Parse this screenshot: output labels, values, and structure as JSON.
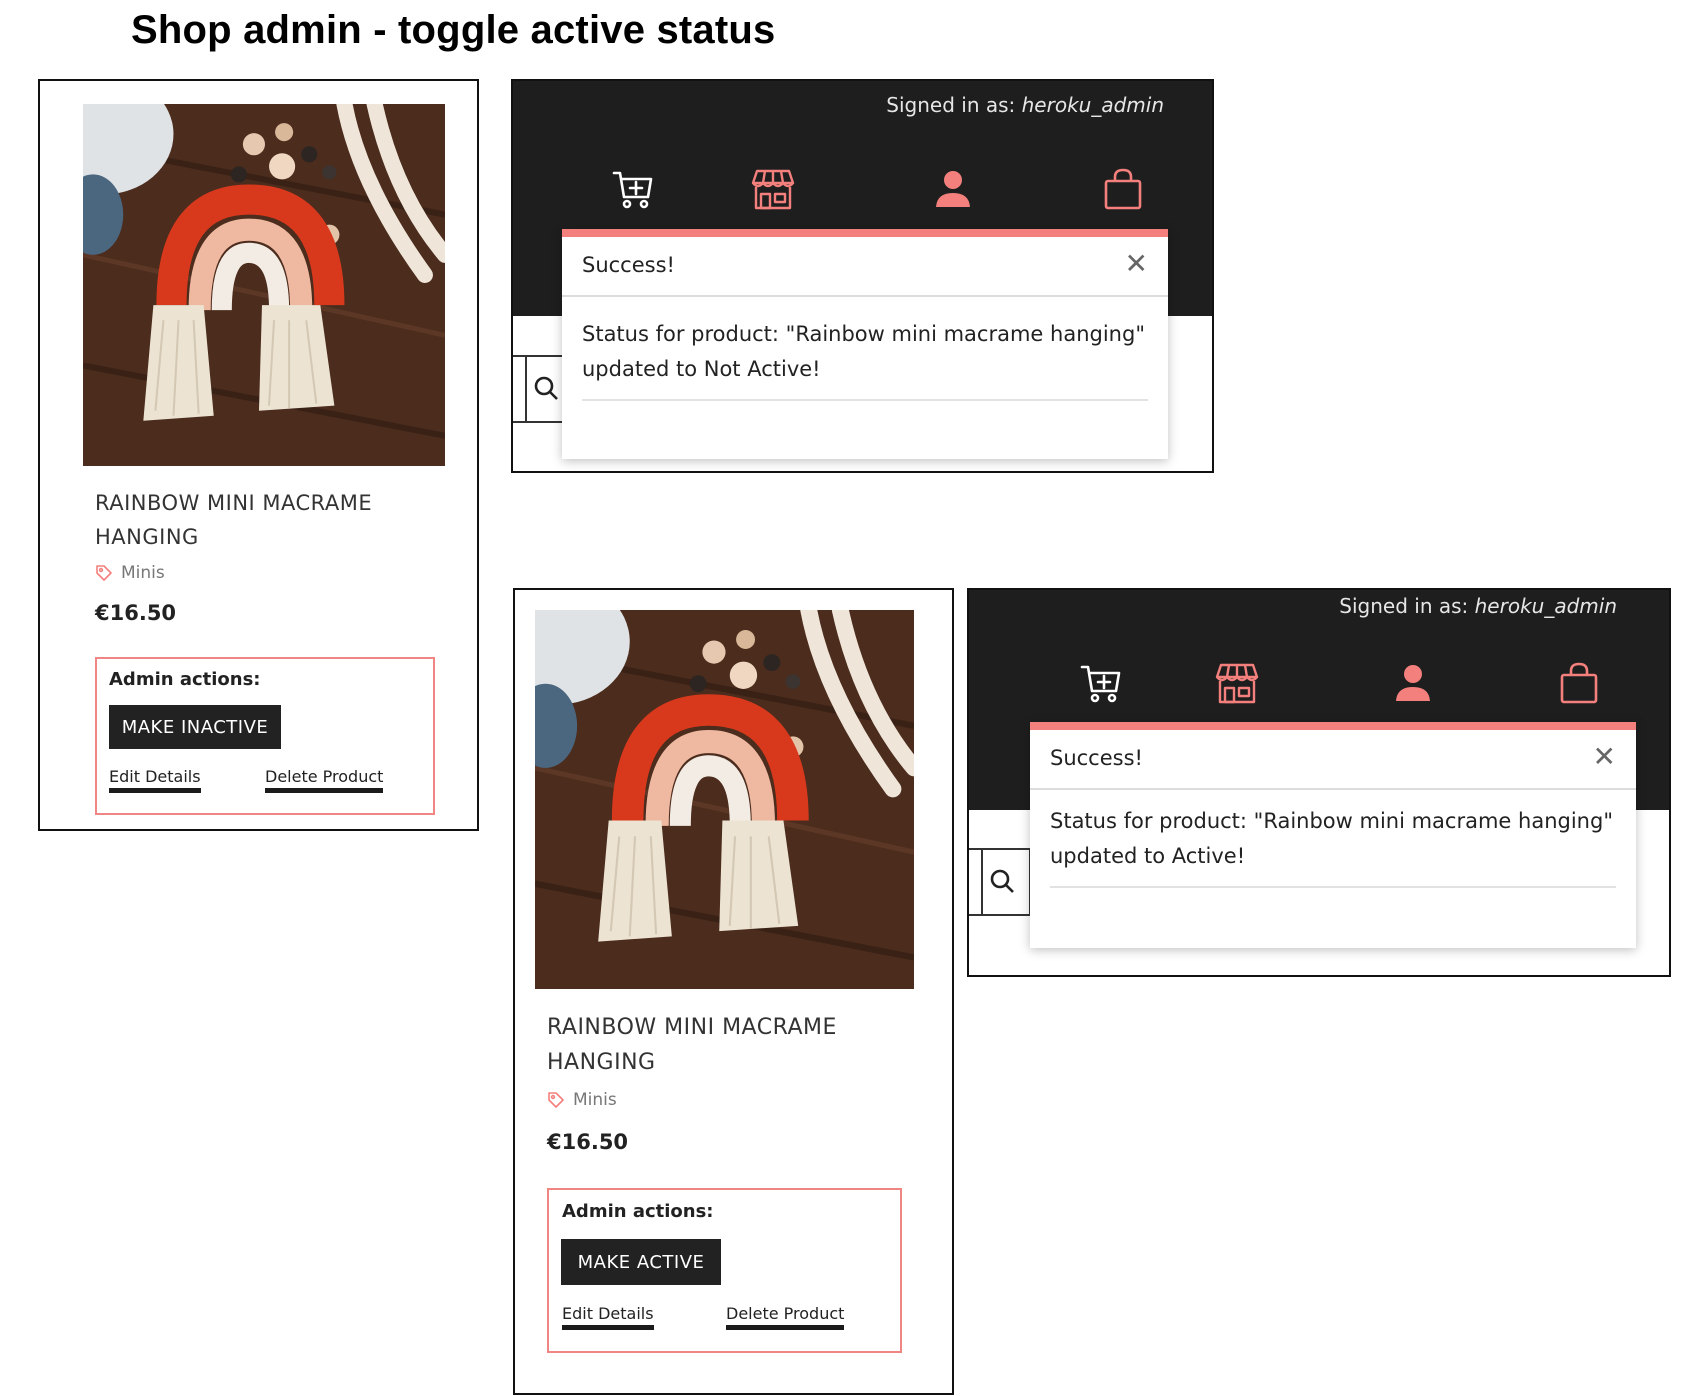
{
  "page": {
    "title": "Shop admin - toggle active status"
  },
  "colors": {
    "accent": "#f4807d",
    "header_bg": "#1e1e1e",
    "button_bg": "#222222"
  },
  "scenario_inactive": {
    "card": {
      "name": "RAINBOW MINI MACRAME HANGING",
      "category": "Minis",
      "price": "€16.50",
      "admin_label": "Admin actions:",
      "toggle_label": "MAKE INACTIVE",
      "edit_label": "Edit Details",
      "delete_label": "Delete Product"
    },
    "header": {
      "signed_in_prefix": "Signed in as:",
      "username": "heroku_admin",
      "icons": [
        "cart-plus-icon",
        "store-icon",
        "user-icon",
        "shopping-bag-icon"
      ]
    },
    "toast": {
      "title": "Success!",
      "close": "✕",
      "message": "Status for product: \"Rainbow mini macrame hanging\" updated to Not Active!"
    }
  },
  "scenario_active": {
    "card": {
      "name": "RAINBOW MINI MACRAME HANGING",
      "category": "Minis",
      "price": "€16.50",
      "admin_label": "Admin actions:",
      "toggle_label": "MAKE ACTIVE",
      "edit_label": "Edit Details",
      "delete_label": "Delete Product"
    },
    "header": {
      "signed_in_prefix": "Signed in as:",
      "username": "heroku_admin",
      "icons": [
        "cart-plus-icon",
        "store-icon",
        "user-icon",
        "shopping-bag-icon"
      ]
    },
    "toast": {
      "title": "Success!",
      "close": "✕",
      "message": "Status for product: \"Rainbow mini macrame hanging\" updated to Active!"
    }
  }
}
